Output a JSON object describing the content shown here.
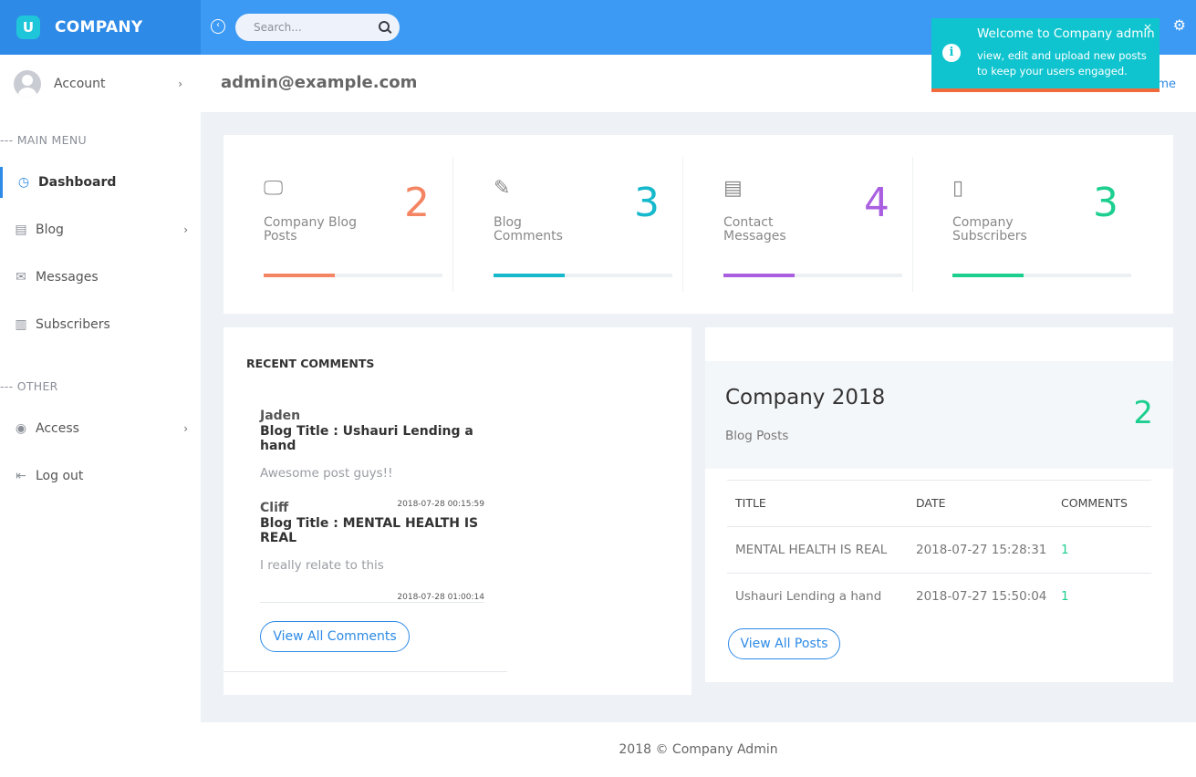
{
  "brand": {
    "logo_letter": "U",
    "name": "COMPANY"
  },
  "topbar": {
    "search_placeholder": "Search..."
  },
  "toast": {
    "title": "Welcome to Company admin",
    "body": "view, edit and upload new posts to keep your users engaged.",
    "close": "×"
  },
  "sidebar": {
    "account_label": "Account",
    "main_menu_label": "--- MAIN MENU",
    "other_label": "--- OTHER",
    "items": [
      {
        "label": "Dashboard",
        "icon": "clock-icon"
      },
      {
        "label": "Blog",
        "icon": "document-icon"
      },
      {
        "label": "Messages",
        "icon": "envelope-icon"
      },
      {
        "label": "Subscribers",
        "icon": "book-icon"
      },
      {
        "label": "Access",
        "icon": "eye-icon"
      },
      {
        "label": "Log out",
        "icon": "logout-icon"
      }
    ]
  },
  "header": {
    "email": "admin@example.com",
    "home_link": "me"
  },
  "stats": [
    {
      "label": "Company Blog Posts",
      "value": "2",
      "color": "#f48562",
      "progress": 0.4,
      "icon": "monitor-icon"
    },
    {
      "label": "Blog Comments",
      "value": "3",
      "color": "#16b8cc",
      "progress": 0.4,
      "icon": "notepad-icon"
    },
    {
      "label": "Contact Messages",
      "value": "4",
      "color": "#a95fe0",
      "progress": 0.4,
      "icon": "document-icon"
    },
    {
      "label": "Company Subscribers",
      "value": "3",
      "color": "#1ccf8f",
      "progress": 0.4,
      "icon": "clipboard-icon"
    }
  ],
  "comments": {
    "title": "RECENT COMMENTS",
    "items": [
      {
        "author": "Jaden",
        "blog_title": "Blog Title : Ushauri Lending a hand",
        "text": "Awesome post guys!!",
        "date": "2018-07-28 00:15:59"
      },
      {
        "author": "Cliff",
        "blog_title": "Blog Title : MENTAL HEALTH IS REAL",
        "text": "I really relate to this",
        "date": "2018-07-28 01:00:14"
      }
    ],
    "button": "View All Comments"
  },
  "posts": {
    "title": "Company 2018",
    "subtitle": "Blog Posts",
    "count": "2",
    "columns": [
      "TITLE",
      "DATE",
      "COMMENTS"
    ],
    "rows": [
      {
        "title": "MENTAL HEALTH IS REAL",
        "date": "2018-07-27 15:28:31",
        "comments": "1"
      },
      {
        "title": "Ushauri Lending a hand",
        "date": "2018-07-27 15:50:04",
        "comments": "1"
      }
    ],
    "button": "View All Posts"
  },
  "footer": {
    "text": "2018 © Company Admin"
  }
}
